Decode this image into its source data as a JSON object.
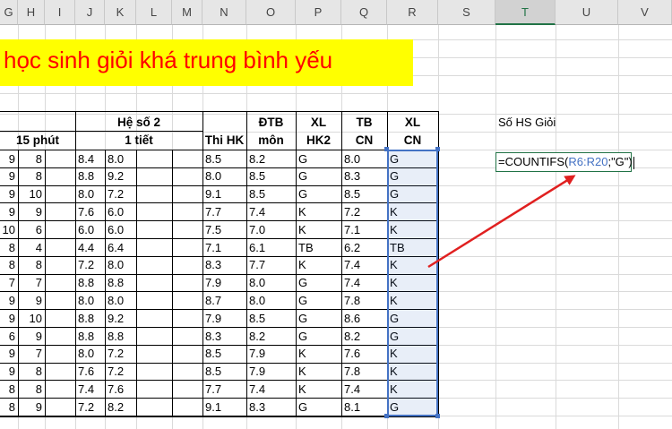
{
  "column_headers": [
    "G",
    "H",
    "I",
    "J",
    "K",
    "L",
    "M",
    "N",
    "O",
    "P",
    "Q",
    "R",
    "S",
    "T",
    "U",
    "V"
  ],
  "title": "học sinh giỏi khá trung bình yếu",
  "table_headers": {
    "he_so_2": "Hệ số 2",
    "mieng_15": "15 phút",
    "mot_tiet": "1 tiết",
    "thi_hk": "Thi HK",
    "dtb_line1": "ĐTB",
    "dtb_line2": "môn",
    "xl_hk2_line1": "XL",
    "xl_hk2_line2": "HK2",
    "tb_cn_line1": "TB",
    "tb_cn_line2": "CN",
    "xl_cn_line1": "XL",
    "xl_cn_line2": "CN"
  },
  "side_label": "Số HS Giỏi",
  "formula": {
    "prefix": "=COUNTIFS(",
    "range": "R6:R20",
    "suffix": ";\"G\")"
  },
  "rows": [
    {
      "g": "9",
      "h": "8",
      "j": "8.4",
      "k": "8.0",
      "n": "8.5",
      "o": "8.2",
      "p": "G",
      "q": "8.0",
      "r": "G"
    },
    {
      "g": "9",
      "h": "8",
      "j": "8.8",
      "k": "9.2",
      "n": "8.0",
      "o": "8.5",
      "p": "G",
      "q": "8.3",
      "r": "G"
    },
    {
      "g": "9",
      "h": "10",
      "j": "8.0",
      "k": "7.2",
      "n": "9.1",
      "o": "8.5",
      "p": "G",
      "q": "8.5",
      "r": "G"
    },
    {
      "g": "9",
      "h": "9",
      "j": "7.6",
      "k": "6.0",
      "n": "7.7",
      "o": "7.4",
      "p": "K",
      "q": "7.2",
      "r": "K"
    },
    {
      "g": "10",
      "h": "6",
      "j": "6.0",
      "k": "6.0",
      "n": "7.5",
      "o": "7.0",
      "p": "K",
      "q": "7.1",
      "r": "K"
    },
    {
      "g": "8",
      "h": "4",
      "j": "4.4",
      "k": "6.4",
      "n": "7.1",
      "o": "6.1",
      "p": "TB",
      "q": "6.2",
      "r": "TB"
    },
    {
      "g": "8",
      "h": "8",
      "j": "7.2",
      "k": "8.0",
      "n": "8.3",
      "o": "7.7",
      "p": "K",
      "q": "7.4",
      "r": "K"
    },
    {
      "g": "7",
      "h": "7",
      "j": "8.8",
      "k": "8.8",
      "n": "7.9",
      "o": "8.0",
      "p": "G",
      "q": "7.4",
      "r": "K"
    },
    {
      "g": "9",
      "h": "9",
      "j": "8.0",
      "k": "8.0",
      "n": "8.7",
      "o": "8.0",
      "p": "G",
      "q": "7.8",
      "r": "K"
    },
    {
      "g": "9",
      "h": "10",
      "j": "8.8",
      "k": "9.2",
      "n": "7.9",
      "o": "8.5",
      "p": "G",
      "q": "8.6",
      "r": "G"
    },
    {
      "g": "6",
      "h": "9",
      "j": "8.8",
      "k": "8.8",
      "n": "8.3",
      "o": "8.2",
      "p": "G",
      "q": "8.2",
      "r": "G"
    },
    {
      "g": "9",
      "h": "7",
      "j": "8.0",
      "k": "7.2",
      "n": "8.5",
      "o": "7.9",
      "p": "K",
      "q": "7.6",
      "r": "K"
    },
    {
      "g": "9",
      "h": "8",
      "j": "7.6",
      "k": "7.2",
      "n": "8.5",
      "o": "7.9",
      "p": "K",
      "q": "7.8",
      "r": "K"
    },
    {
      "g": "8",
      "h": "8",
      "j": "7.4",
      "k": "7.6",
      "n": "7.7",
      "o": "7.4",
      "p": "K",
      "q": "7.4",
      "r": "K"
    },
    {
      "g": "8",
      "h": "9",
      "j": "7.2",
      "k": "8.2",
      "n": "9.1",
      "o": "8.3",
      "p": "G",
      "q": "8.1",
      "r": "G"
    }
  ],
  "colors": {
    "title_bg": "#ffff00",
    "title_text": "#ff0000",
    "range_outline": "#4472c4",
    "formula_range": "#4472c4",
    "arrow": "#e02020",
    "active_cell_border": "#217346"
  }
}
